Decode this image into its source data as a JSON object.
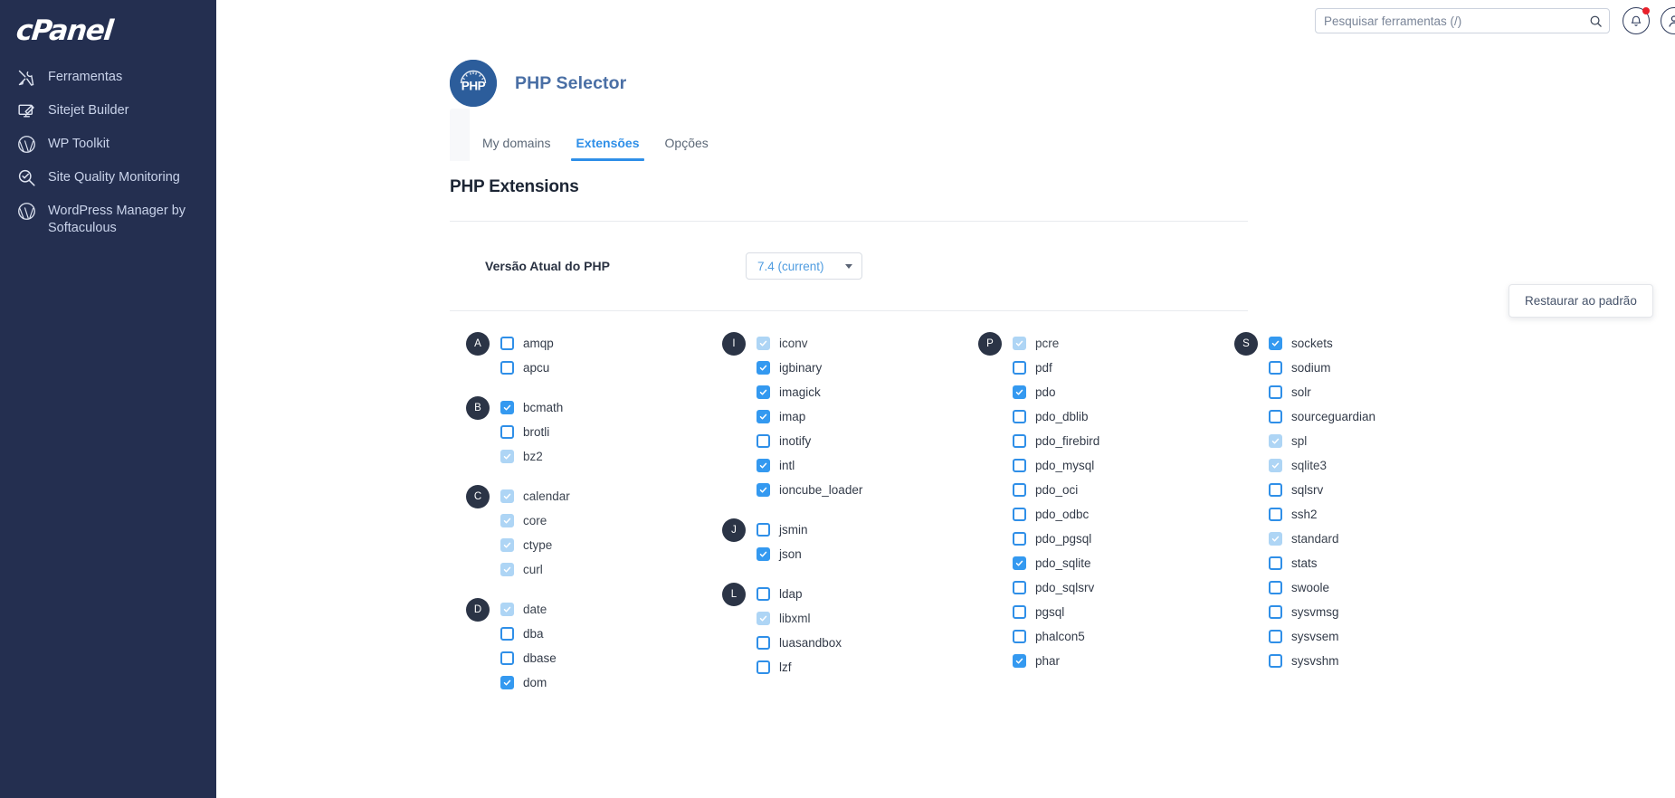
{
  "sidebar": {
    "brand": "cPanel",
    "items": [
      {
        "label": "Ferramentas",
        "icon": "tools-icon"
      },
      {
        "label": "Sitejet Builder",
        "icon": "monitor-icon"
      },
      {
        "label": "WP Toolkit",
        "icon": "wordpress-icon"
      },
      {
        "label": "Site Quality Monitoring",
        "icon": "magnifier-check-icon"
      },
      {
        "label": "WordPress Manager by Softaculous",
        "icon": "wordpress-icon"
      }
    ]
  },
  "topbar": {
    "search_placeholder": "Pesquisar ferramentas (/)",
    "search_value": "",
    "search_icon": "search-icon",
    "notifications_icon": "bell-icon",
    "account_icon": "user-icon"
  },
  "app": {
    "title": "PHP Selector",
    "badge_text": "PHP"
  },
  "tabs": [
    {
      "label": "My domains",
      "active": false
    },
    {
      "label": "Extensões",
      "active": true
    },
    {
      "label": "Opções",
      "active": false
    }
  ],
  "card": {
    "title": "PHP Extensions",
    "restore_button": "Restaurar ao padrão",
    "version_label": "Versão Atual do PHP",
    "version_value": "7.4 (current)"
  },
  "extension_columns": [
    {
      "groups": [
        {
          "letter": "A",
          "items": [
            {
              "name": "amqp",
              "state": "off"
            },
            {
              "name": "apcu",
              "state": "off"
            }
          ]
        },
        {
          "letter": "B",
          "items": [
            {
              "name": "bcmath",
              "state": "on"
            },
            {
              "name": "brotli",
              "state": "off"
            },
            {
              "name": "bz2",
              "state": "locked"
            }
          ]
        },
        {
          "letter": "C",
          "items": [
            {
              "name": "calendar",
              "state": "locked"
            },
            {
              "name": "core",
              "state": "locked"
            },
            {
              "name": "ctype",
              "state": "locked"
            },
            {
              "name": "curl",
              "state": "locked"
            }
          ]
        },
        {
          "letter": "D",
          "items": [
            {
              "name": "date",
              "state": "locked"
            },
            {
              "name": "dba",
              "state": "off"
            },
            {
              "name": "dbase",
              "state": "off"
            },
            {
              "name": "dom",
              "state": "on"
            }
          ]
        }
      ]
    },
    {
      "groups": [
        {
          "letter": "I",
          "items": [
            {
              "name": "iconv",
              "state": "locked"
            },
            {
              "name": "igbinary",
              "state": "on"
            },
            {
              "name": "imagick",
              "state": "on"
            },
            {
              "name": "imap",
              "state": "on"
            },
            {
              "name": "inotify",
              "state": "off"
            },
            {
              "name": "intl",
              "state": "on"
            },
            {
              "name": "ioncube_loader",
              "state": "on"
            }
          ]
        },
        {
          "letter": "J",
          "items": [
            {
              "name": "jsmin",
              "state": "off"
            },
            {
              "name": "json",
              "state": "on"
            }
          ]
        },
        {
          "letter": "L",
          "items": [
            {
              "name": "ldap",
              "state": "off"
            },
            {
              "name": "libxml",
              "state": "locked"
            },
            {
              "name": "luasandbox",
              "state": "off"
            },
            {
              "name": "lzf",
              "state": "off"
            }
          ]
        }
      ]
    },
    {
      "groups": [
        {
          "letter": "P",
          "items": [
            {
              "name": "pcre",
              "state": "locked"
            },
            {
              "name": "pdf",
              "state": "off"
            },
            {
              "name": "pdo",
              "state": "on"
            },
            {
              "name": "pdo_dblib",
              "state": "off"
            },
            {
              "name": "pdo_firebird",
              "state": "off"
            },
            {
              "name": "pdo_mysql",
              "state": "off"
            },
            {
              "name": "pdo_oci",
              "state": "off"
            },
            {
              "name": "pdo_odbc",
              "state": "off"
            },
            {
              "name": "pdo_pgsql",
              "state": "off"
            },
            {
              "name": "pdo_sqlite",
              "state": "on"
            },
            {
              "name": "pdo_sqlsrv",
              "state": "off"
            },
            {
              "name": "pgsql",
              "state": "off"
            },
            {
              "name": "phalcon5",
              "state": "off"
            },
            {
              "name": "phar",
              "state": "on"
            }
          ]
        }
      ]
    },
    {
      "groups": [
        {
          "letter": "S",
          "items": [
            {
              "name": "sockets",
              "state": "on"
            },
            {
              "name": "sodium",
              "state": "off"
            },
            {
              "name": "solr",
              "state": "off"
            },
            {
              "name": "sourceguardian",
              "state": "off"
            },
            {
              "name": "spl",
              "state": "locked"
            },
            {
              "name": "sqlite3",
              "state": "locked"
            },
            {
              "name": "sqlsrv",
              "state": "off"
            },
            {
              "name": "ssh2",
              "state": "off"
            },
            {
              "name": "standard",
              "state": "locked"
            },
            {
              "name": "stats",
              "state": "off"
            },
            {
              "name": "swoole",
              "state": "off"
            },
            {
              "name": "sysvmsg",
              "state": "off"
            },
            {
              "name": "sysvsem",
              "state": "off"
            },
            {
              "name": "sysvshm",
              "state": "off"
            }
          ]
        }
      ]
    }
  ],
  "colors": {
    "sidebar_bg": "#242f50",
    "accent_blue": "#2f8fe8",
    "checkbox_on": "#3499f0",
    "checkbox_locked": "#aed5f5",
    "badge_dark": "#2b3446",
    "notification_dot": "#e8202a"
  }
}
